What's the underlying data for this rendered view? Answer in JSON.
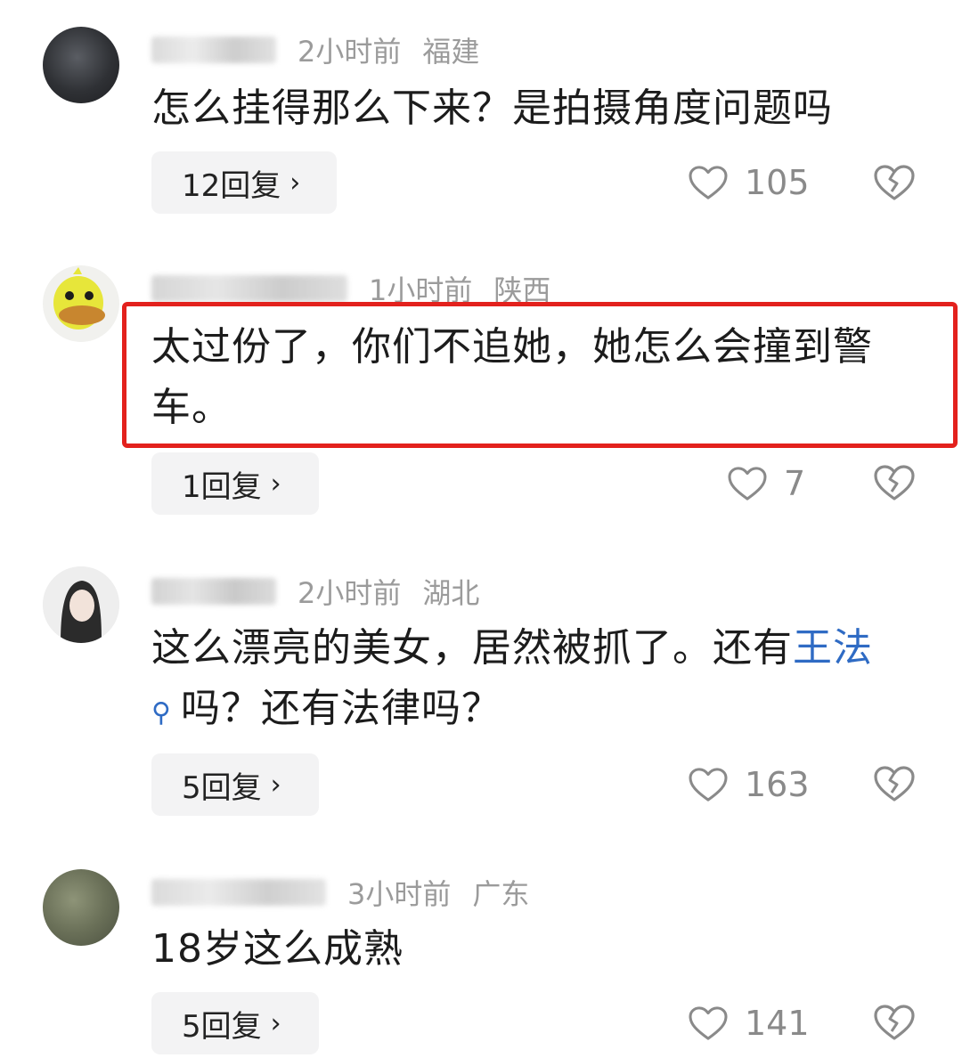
{
  "comments": [
    {
      "username": "",
      "time": "2小时前",
      "location": "福建",
      "text": "怎么挂得那么下来？是拍摄角度问题吗",
      "replies": "12回复",
      "likes": "105"
    },
    {
      "username": "",
      "time": "1小时前",
      "location": "陕西",
      "text": "太过份了，你们不追她，她怎么会撞到警车。",
      "replies": "1回复",
      "likes": "7"
    },
    {
      "username": "",
      "time": "2小时前",
      "location": "湖北",
      "text_before": "这么漂亮的美女，居然被抓了。还有",
      "link": "王法",
      "text_after": "吗？还有法律吗？",
      "replies": "5回复",
      "likes": "163"
    },
    {
      "username": "",
      "time": "3小时前",
      "location": "广东",
      "text": "18岁这么成熟",
      "replies": "5回复",
      "likes": "141"
    }
  ],
  "icons": {
    "like": "heart-outline-icon",
    "dislike": "broken-heart-icon",
    "reply_chevron": "chevron-right-icon",
    "link_search": "search-icon"
  },
  "colors": {
    "highlight_border": "#e3211d",
    "link": "#2f6bc4",
    "meta_text": "#9b9b9b"
  }
}
